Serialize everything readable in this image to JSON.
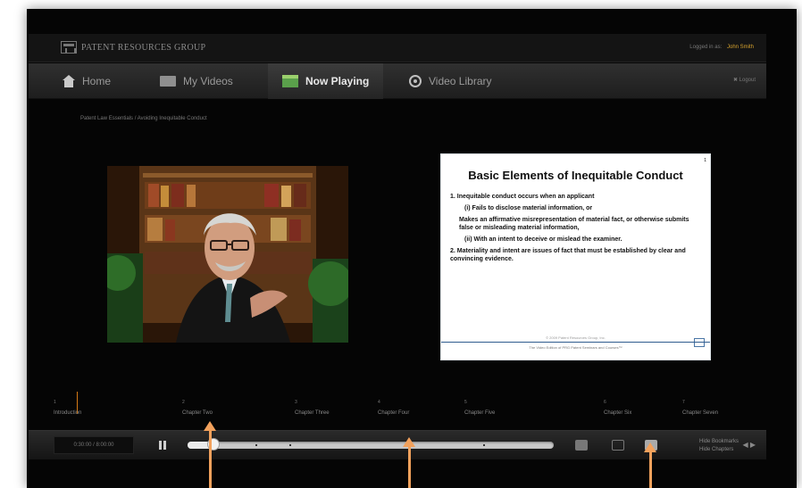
{
  "header": {
    "brand": "PATENT RESOURCES GROUP",
    "login_label": "Logged in as:",
    "user": "John Smith"
  },
  "nav": {
    "home": "Home",
    "my_videos": "My Videos",
    "now_playing": "Now Playing",
    "video_library": "Video Library",
    "logout": "Logout"
  },
  "breadcrumb": "Patent Law Essentials / Avoiding Inequitable Conduct",
  "slide": {
    "number": "1",
    "title": "Basic Elements of Inequitable Conduct",
    "lines": [
      "1.  Inequitable conduct occurs when an applicant",
      "(i)  Fails to disclose material information, or",
      "Makes an affirmative misrepresentation of material fact, or otherwise submits false or misleading material information,",
      "(ii)  With an intent to deceive or mislead the examiner.",
      "2.  Materiality and intent are issues of fact that must be established by clear and convincing evidence."
    ],
    "copyright": "© 2009 Patent Resources Group, Inc.",
    "footer": "The Video Edition of PRG Patent Seminars and Courses™"
  },
  "chapters": [
    {
      "num": "1",
      "label": "Introduction"
    },
    {
      "num": "2",
      "label": "Chapter Two"
    },
    {
      "num": "3",
      "label": "Chapter Three"
    },
    {
      "num": "4",
      "label": "Chapter Four"
    },
    {
      "num": "5",
      "label": "Chapter Five"
    },
    {
      "num": "6",
      "label": "Chapter Six"
    },
    {
      "num": "7",
      "label": "Chapter Seven"
    }
  ],
  "controls": {
    "timecode": "0:30:00 / 8:00:00",
    "progress": 0.07,
    "hide_bookmarks": "Hide Bookmarks",
    "hide_chapters": "Hide Chapters",
    "nav_arrow": "◀ ▶"
  },
  "colors": {
    "accent": "#d6a22e",
    "callout": "#f2a15c"
  }
}
